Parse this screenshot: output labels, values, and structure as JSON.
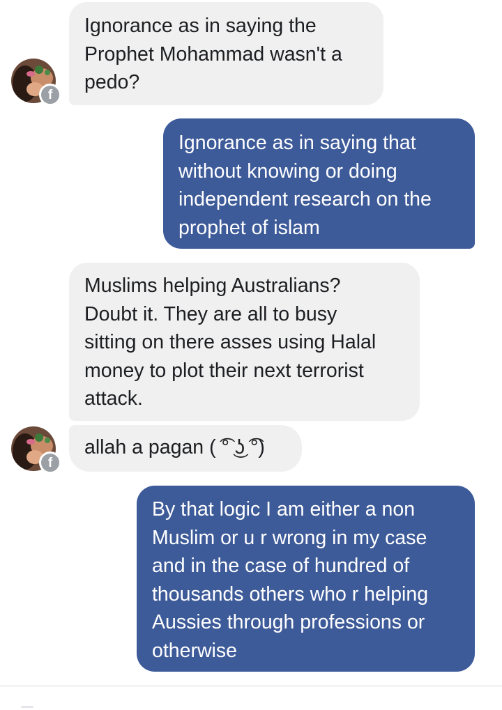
{
  "thread": {
    "messages": [
      {
        "sender": "other",
        "text": "Ignorance as in saying the\nProphet Mohammad wasn't a\npedo?",
        "show_avatar": true
      },
      {
        "sender": "me",
        "text": "Ignorance as in saying that\nwithout knowing or doing\nindependent research on the\nprophet of islam"
      },
      {
        "sender": "other",
        "text": "Muslims helping Australians?\nDoubt it. They are all to busy\nsitting on there asses using Halal\nmoney to plot their next terrorist\nattack.",
        "show_avatar": false
      },
      {
        "sender": "other",
        "text": "allah a pagan ( ͡° ͜ʖ ͡°)",
        "show_avatar": true
      },
      {
        "sender": "me",
        "text": "By that logic I am either a non\nMuslim or u r wrong in my case\nand in the case of hundred of\nthousands others who r helping\nAussies through professions or\notherwise"
      }
    ],
    "badge_glyph": "f",
    "badge_icon": "facebook-icon",
    "colors": {
      "incoming_bubble": "#f0f0f0",
      "outgoing_bubble": "#3d5a99",
      "incoming_text": "#1c1e21",
      "outgoing_text": "#ffffff"
    }
  }
}
